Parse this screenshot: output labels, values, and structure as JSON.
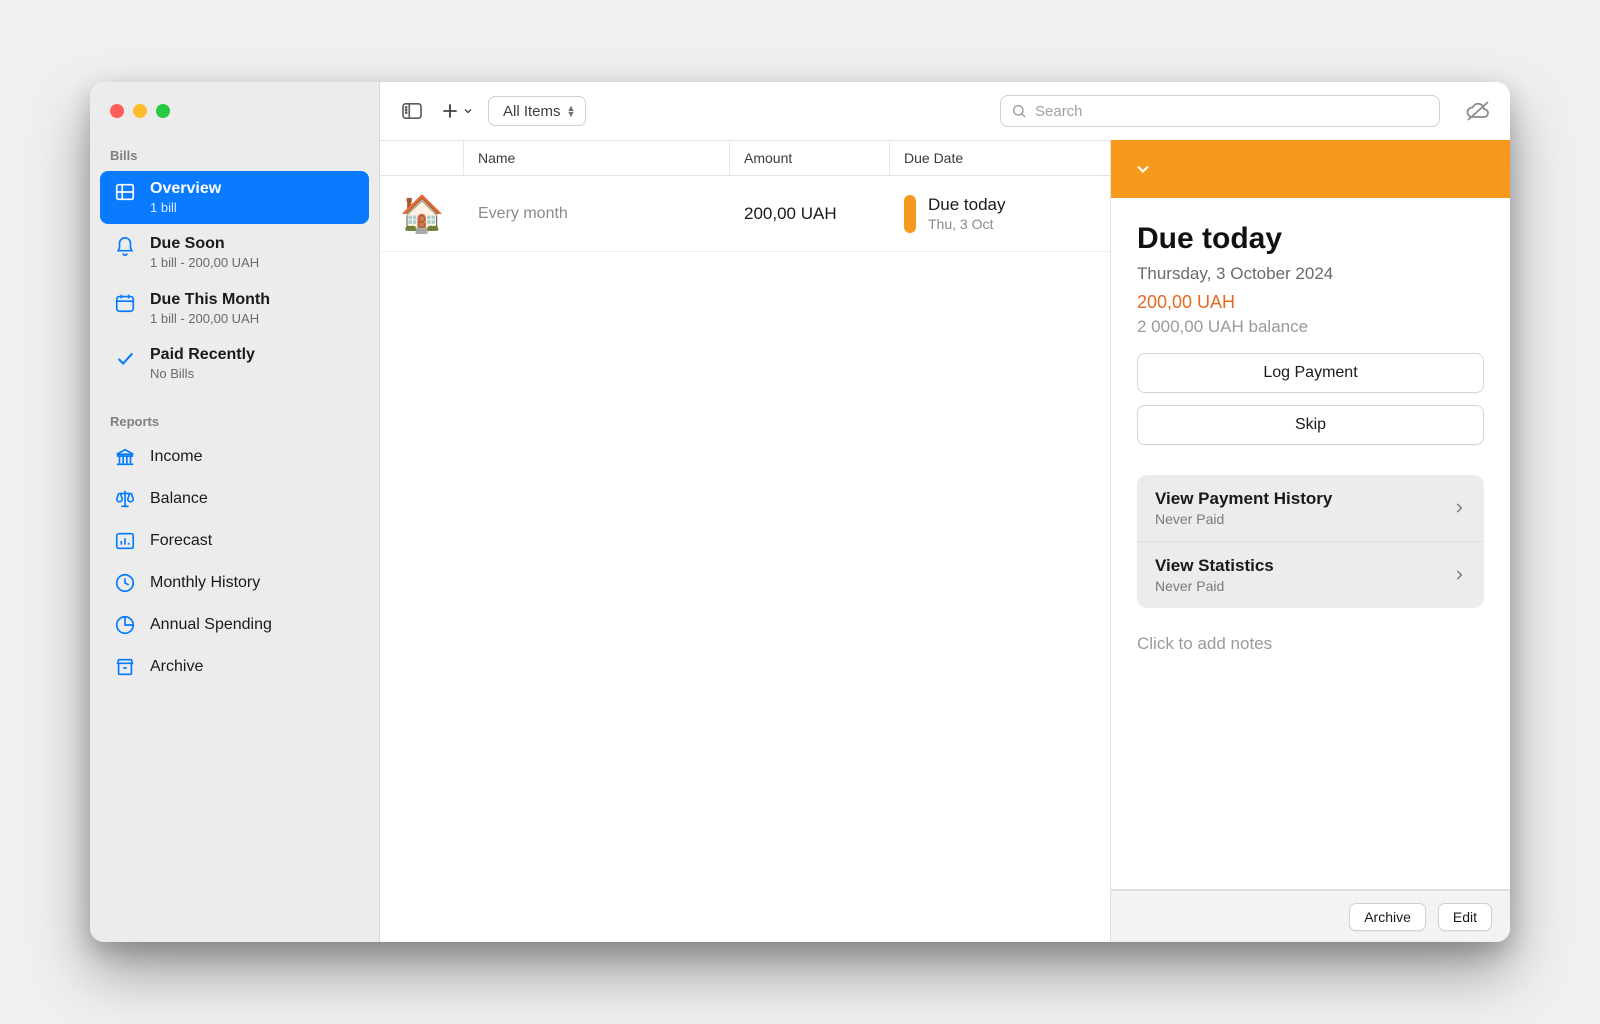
{
  "toolbar": {
    "filter_label": "All Items",
    "search_placeholder": "Search"
  },
  "sidebar": {
    "bills_section": "Bills",
    "reports_section": "Reports",
    "items": [
      {
        "label": "Overview",
        "sub": "1 bill"
      },
      {
        "label": "Due Soon",
        "sub": "1 bill - 200,00 UAH"
      },
      {
        "label": "Due This Month",
        "sub": "1 bill - 200,00 UAH"
      },
      {
        "label": "Paid Recently",
        "sub": "No Bills"
      }
    ],
    "reports": [
      {
        "label": "Income"
      },
      {
        "label": "Balance"
      },
      {
        "label": "Forecast"
      },
      {
        "label": "Monthly History"
      },
      {
        "label": "Annual Spending"
      },
      {
        "label": "Archive"
      }
    ]
  },
  "columns": {
    "name": "Name",
    "amount": "Amount",
    "due": "Due Date"
  },
  "rows": [
    {
      "icon": "🏠",
      "name": "Every month",
      "amount": "200,00 UAH",
      "due_title": "Due today",
      "due_sub": "Thu, 3 Oct"
    }
  ],
  "detail": {
    "title": "Due today",
    "date": "Thursday, 3 October 2024",
    "amount": "200,00 UAH",
    "balance": "2 000,00 UAH  balance",
    "log_payment": "Log Payment",
    "skip": "Skip",
    "history": {
      "title": "View Payment History",
      "sub": "Never Paid"
    },
    "stats": {
      "title": "View Statistics",
      "sub": "Never Paid"
    },
    "notes_placeholder": "Click to add notes",
    "archive": "Archive",
    "edit": "Edit"
  }
}
